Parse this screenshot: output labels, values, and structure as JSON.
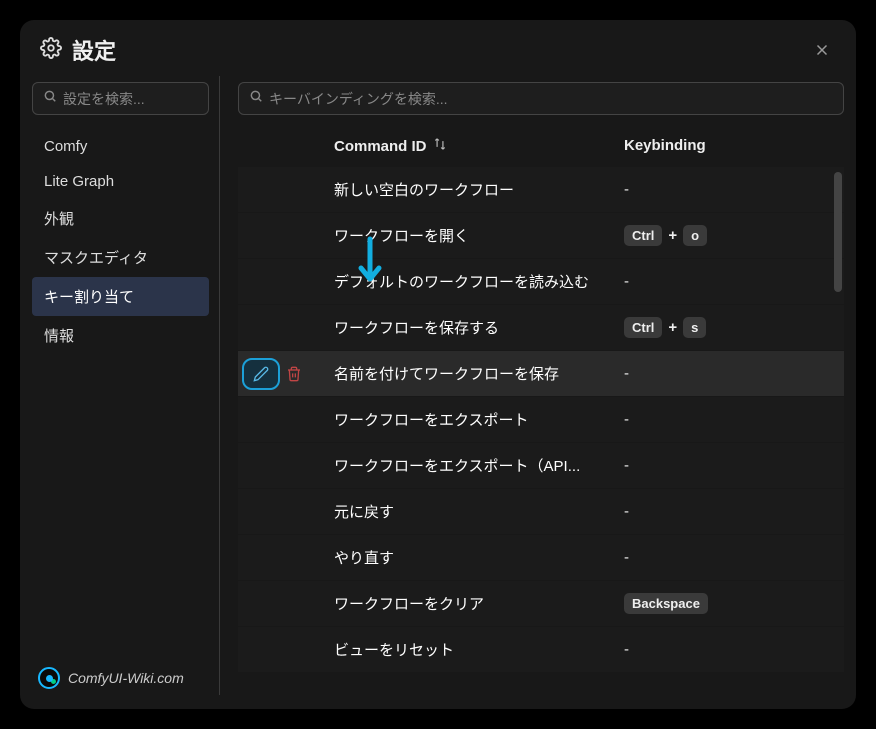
{
  "header": {
    "title": "設定"
  },
  "sidebar": {
    "search_placeholder": "設定を検索...",
    "items": [
      {
        "label": "Comfy"
      },
      {
        "label": "Lite Graph"
      },
      {
        "label": "外観"
      },
      {
        "label": "マスクエディタ"
      },
      {
        "label": "キー割り当て"
      },
      {
        "label": "情報"
      }
    ],
    "active_index": 4
  },
  "main": {
    "search_placeholder": "キーバインディングを検索...",
    "columns": {
      "command": "Command ID",
      "keybinding": "Keybinding"
    },
    "rows": [
      {
        "command": "新しい空白のワークフロー",
        "keys": null
      },
      {
        "command": "ワークフローを開く",
        "keys": [
          "Ctrl",
          "o"
        ]
      },
      {
        "command": "デフォルトのワークフローを読み込む",
        "keys": null
      },
      {
        "command": "ワークフローを保存する",
        "keys": [
          "Ctrl",
          "s"
        ]
      },
      {
        "command": "名前を付けてワークフローを保存",
        "keys": null,
        "hovered": true,
        "show_actions": true
      },
      {
        "command": "ワークフローをエクスポート",
        "keys": null
      },
      {
        "command": "ワークフローをエクスポート（API...",
        "keys": null
      },
      {
        "command": "元に戻す",
        "keys": null
      },
      {
        "command": "やり直す",
        "keys": null
      },
      {
        "command": "ワークフローをクリア",
        "keys": [
          "Backspace"
        ]
      },
      {
        "command": "ビューをリセット",
        "keys": null
      }
    ]
  },
  "watermark": {
    "text": "ComfyUI-Wiki.com"
  }
}
